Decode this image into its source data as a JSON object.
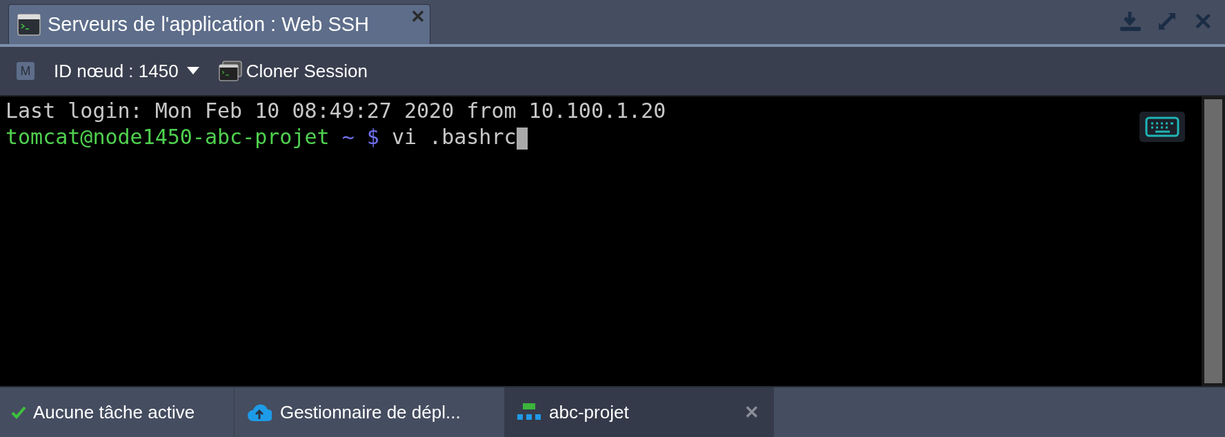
{
  "window": {
    "title": "Serveurs de l'application : Web SSH",
    "close": "✕"
  },
  "toolbar": {
    "node_badge": "M",
    "node_label": "ID nœud : 1450",
    "clone_label": "Cloner Session"
  },
  "terminal": {
    "lines": [
      {
        "kind": "plain",
        "text": "Last login: Mon Feb 10 08:49:27 2020 from 10.100.1.20"
      },
      {
        "kind": "prompt",
        "user": "tomcat@node1450-abc-projet",
        "path": "~",
        "symbol": "$",
        "command": "vi .bashrc",
        "cursor": true
      }
    ]
  },
  "status_bar": {
    "tasks": "Aucune tâche active",
    "tabs": [
      {
        "kind": "deploy",
        "label": "Gestionnaire de dépl...",
        "selected": false,
        "closable": false
      },
      {
        "kind": "env",
        "label": "abc-projet",
        "selected": true,
        "closable": true
      }
    ],
    "close": "✕"
  }
}
